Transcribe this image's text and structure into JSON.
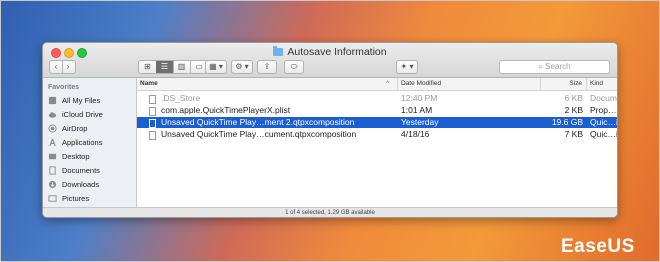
{
  "window": {
    "title": "Autosave Information"
  },
  "toolbar": {
    "back": "‹",
    "forward": "›",
    "views": [
      "⊞",
      "☰",
      "▥",
      "▭"
    ],
    "arrange": "▦ ▾",
    "action": "⚙ ▾",
    "share": "⇪",
    "tag": "⬭",
    "dropbox": "✦ ▾",
    "search_placeholder": "Search"
  },
  "sidebar": {
    "heading": "Favorites",
    "items": [
      {
        "label": "All My Files",
        "icon": "all-files-icon"
      },
      {
        "label": "iCloud Drive",
        "icon": "cloud-icon"
      },
      {
        "label": "AirDrop",
        "icon": "airdrop-icon"
      },
      {
        "label": "Applications",
        "icon": "applications-icon"
      },
      {
        "label": "Desktop",
        "icon": "desktop-icon"
      },
      {
        "label": "Documents",
        "icon": "documents-icon"
      },
      {
        "label": "Downloads",
        "icon": "downloads-icon"
      },
      {
        "label": "Pictures",
        "icon": "pictures-icon"
      }
    ]
  },
  "columns": {
    "name": "Name",
    "date": "Date Modified",
    "size": "Size",
    "kind": "Kind",
    "sort_arrow": "^"
  },
  "files": [
    {
      "name": ".DS_Store",
      "date": "12:40 PM",
      "size": "6 KB",
      "kind": "Document",
      "selected": false,
      "muted": true
    },
    {
      "name": "com.apple.QuickTimePlayerX.plist",
      "date": "1:01 AM",
      "size": "2 KB",
      "kind": "Prop…List",
      "selected": false,
      "muted": false
    },
    {
      "name": "Unsaved QuickTime Play…ment 2.qtpxcomposition",
      "date": "Yesterday",
      "size": "19.6 GB",
      "kind": "Quic…ition",
      "selected": true,
      "muted": false
    },
    {
      "name": "Unsaved QuickTime Play…cument.qtpxcomposition",
      "date": "4/18/16",
      "size": "7 KB",
      "kind": "Quic…ition",
      "selected": false,
      "muted": false
    }
  ],
  "status": "1 of 4 selected, 1.29 GB available",
  "watermark": "EaseUS",
  "colors": {
    "selection": "#1a5ed1",
    "close": "#fc5f57",
    "minimize": "#fdbc2e",
    "maximize": "#28c840"
  }
}
